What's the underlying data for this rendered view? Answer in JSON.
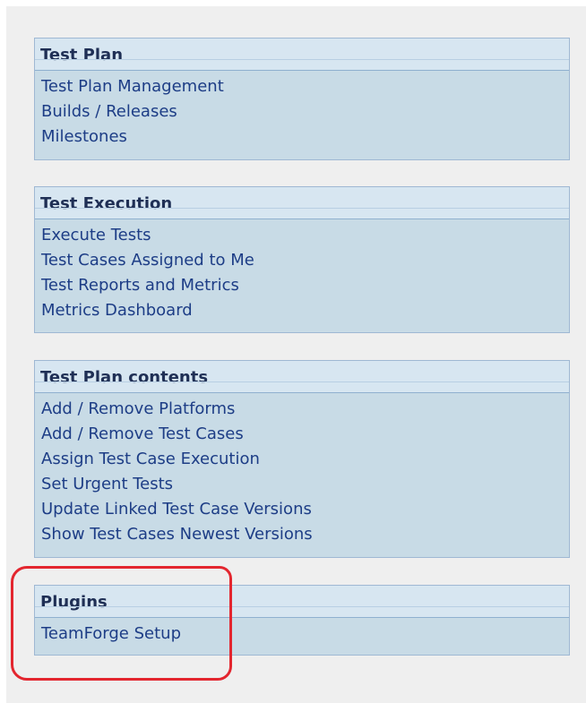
{
  "panels": [
    {
      "title": "Test Plan",
      "links": [
        "Test Plan Management",
        "Builds / Releases",
        "Milestones"
      ]
    },
    {
      "title": "Test Execution",
      "links": [
        "Execute Tests",
        "Test Cases Assigned to Me",
        "Test Reports and Metrics",
        "Metrics Dashboard"
      ]
    },
    {
      "title": "Test Plan contents",
      "links": [
        "Add / Remove Platforms",
        "Add / Remove Test Cases",
        "Assign Test Case Execution",
        "Set Urgent Tests",
        "Update Linked Test Case Versions",
        "Show Test Cases Newest Versions"
      ]
    },
    {
      "title": "Plugins",
      "links": [
        "TeamForge Setup"
      ]
    }
  ],
  "colors": {
    "panel_bg": "#c8dbe6",
    "header_bg": "#d7e6f1",
    "title_text": "#1f2f55",
    "link_text": "#1d3d86",
    "highlight": "#e3262f"
  }
}
